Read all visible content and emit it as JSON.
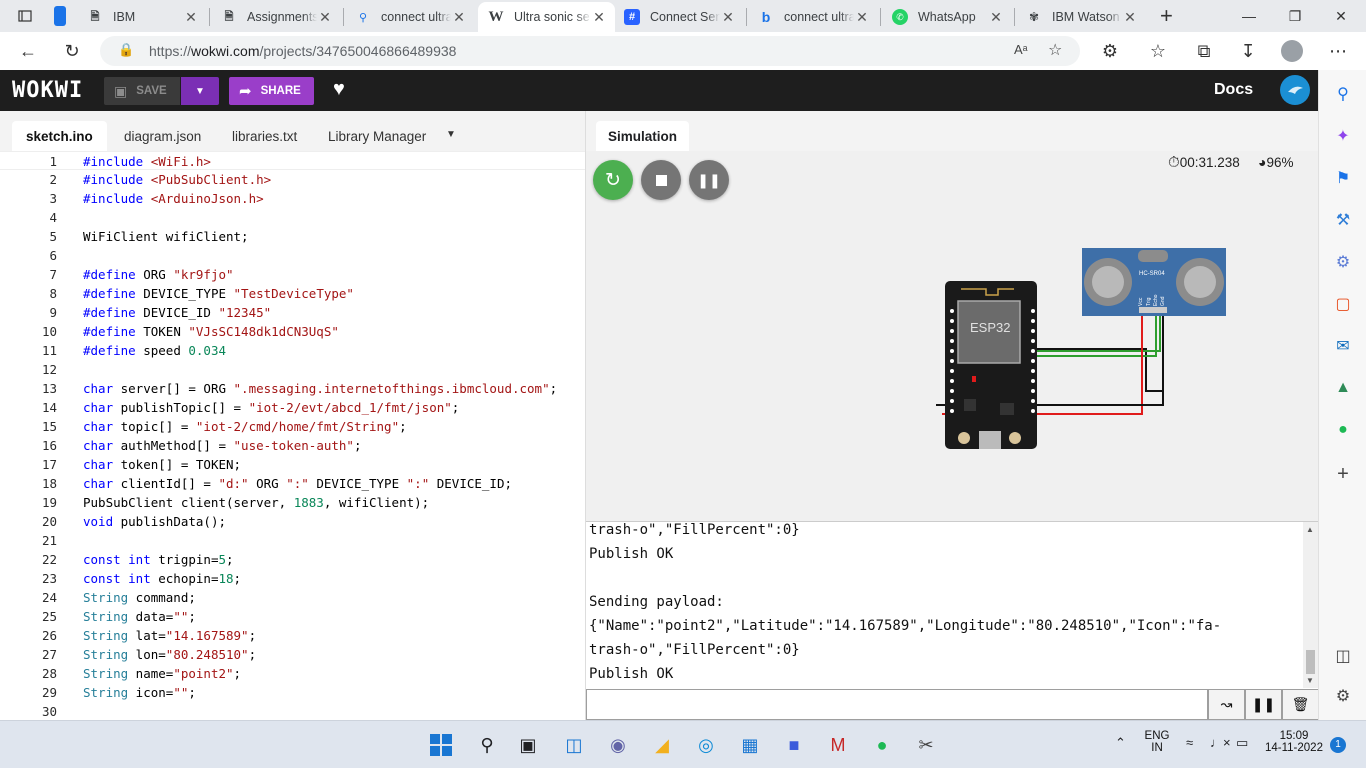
{
  "browser": {
    "tabs": [
      {
        "title": "IBM",
        "icon": "page-icon"
      },
      {
        "title": "Assignments",
        "icon": "page-icon"
      },
      {
        "title": "connect ultra",
        "icon": "search-icon"
      },
      {
        "title": "Ultra sonic se",
        "icon": "wikipedia-icon",
        "active": true
      },
      {
        "title": "Connect Sen",
        "icon": "hashnode-icon"
      },
      {
        "title": "connect ultra",
        "icon": "bing-icon"
      },
      {
        "title": "WhatsApp",
        "icon": "whatsapp-icon"
      },
      {
        "title": "IBM Watson",
        "icon": "ibm-watson-icon"
      }
    ],
    "url_scheme": "https://",
    "url_host": "wokwi.com",
    "url_path": "/projects/347650046866489938"
  },
  "wokwi": {
    "logo": "WOKWI",
    "save_label": "SAVE",
    "share_label": "SHARE",
    "docs_label": "Docs"
  },
  "editor": {
    "tabs": [
      "sketch.ino",
      "diagram.json",
      "libraries.txt",
      "Library Manager"
    ],
    "active_tab": "sketch.ino"
  },
  "simulation": {
    "tab_label": "Simulation",
    "timer": "00:31.238",
    "cpu": "96%",
    "esp32_label": "ESP32",
    "sensor_label": "HC-SR04",
    "pins": [
      "Vcc",
      "Trig",
      "Echo",
      "Gnd"
    ]
  },
  "serial": {
    "lines": [
      "trash-o\",\"FillPercent\":0}",
      "Publish OK",
      "",
      "Sending payload:",
      "{\"Name\":\"point2\",\"Latitude\":\"14.167589\",\"Longitude\":\"80.248510\",\"Icon\":\"fa-",
      "trash-o\",\"FillPercent\":0}",
      "Publish OK"
    ]
  },
  "taskbar": {
    "lang_top": "ENG",
    "lang_bottom": "IN",
    "time": "15:09",
    "date": "14-11-2022",
    "notification_count": "1"
  },
  "colors": {
    "wokwi_header": "#1e1e1e",
    "share_purple": "#9a3ec9",
    "restart_green": "#4caf50",
    "control_gray": "#757575",
    "wire_green": "#2e9e2e",
    "wire_red": "#e01b1b",
    "wire_black": "#111111"
  }
}
